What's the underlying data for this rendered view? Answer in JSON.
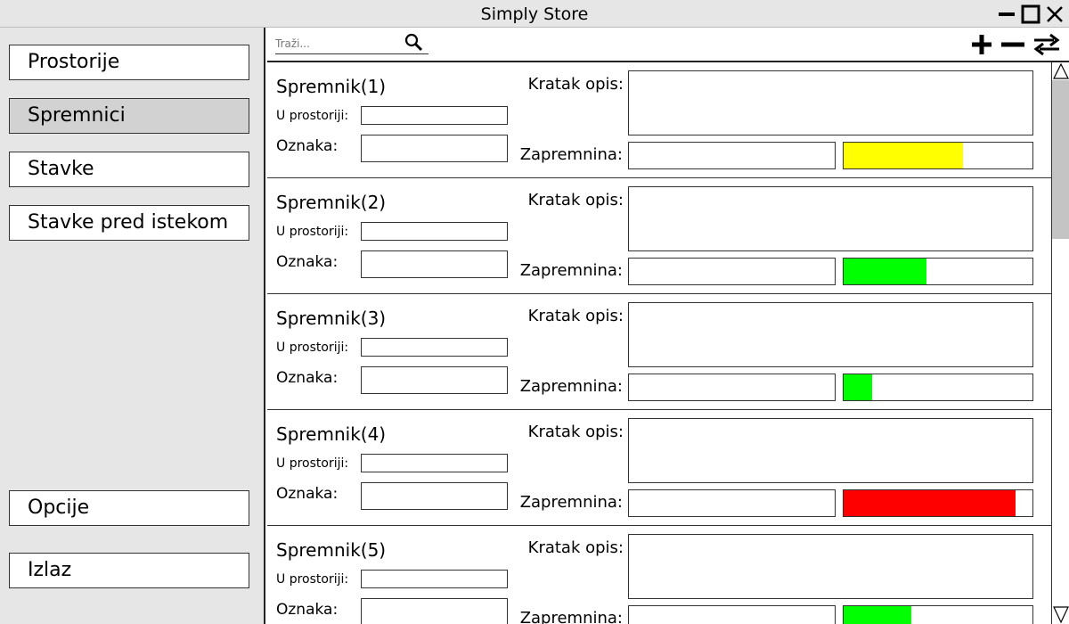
{
  "window": {
    "title": "Simply Store",
    "controls": [
      "minimize-icon",
      "maximize-icon",
      "close-icon"
    ]
  },
  "sidebar": {
    "items": [
      {
        "label": "Prostorije",
        "active": false
      },
      {
        "label": "Spremnici",
        "active": true
      },
      {
        "label": "Stavke",
        "active": false
      },
      {
        "label": "Stavke pred istekom",
        "active": false
      }
    ],
    "bottom_items": [
      {
        "label": "Opcije"
      },
      {
        "label": "Izlaz"
      }
    ]
  },
  "toolbar": {
    "search_placeholder": "Traži...",
    "search_value": "",
    "icons": [
      "search-icon",
      "add-icon",
      "remove-icon",
      "swap-icon"
    ]
  },
  "labels": {
    "room": "U prostoriji:",
    "tag": "Oznaka:",
    "description": "Kratak opis:",
    "volume": "Zapremnina:"
  },
  "containers": [
    {
      "title": "Spremnik(1)",
      "room": "",
      "tag": "",
      "description": "",
      "volume": "",
      "fill": 0.63,
      "fill_color": "#ffff00"
    },
    {
      "title": "Spremnik(2)",
      "room": "",
      "tag": "",
      "description": "",
      "volume": "",
      "fill": 0.44,
      "fill_color": "#00ff00"
    },
    {
      "title": "Spremnik(3)",
      "room": "",
      "tag": "",
      "description": "",
      "volume": "",
      "fill": 0.15,
      "fill_color": "#00ff00"
    },
    {
      "title": "Spremnik(4)",
      "room": "",
      "tag": "",
      "description": "",
      "volume": "",
      "fill": 0.91,
      "fill_color": "#ff0000"
    },
    {
      "title": "Spremnik(5)",
      "room": "",
      "tag": "",
      "description": "",
      "volume": "",
      "fill": 0.36,
      "fill_color": "#00ff00"
    }
  ],
  "colors": {
    "sidebar_bg": "#e6e6e6",
    "active_nav": "#d2d2d2",
    "scroll_thumb": "#c4c4c4"
  }
}
